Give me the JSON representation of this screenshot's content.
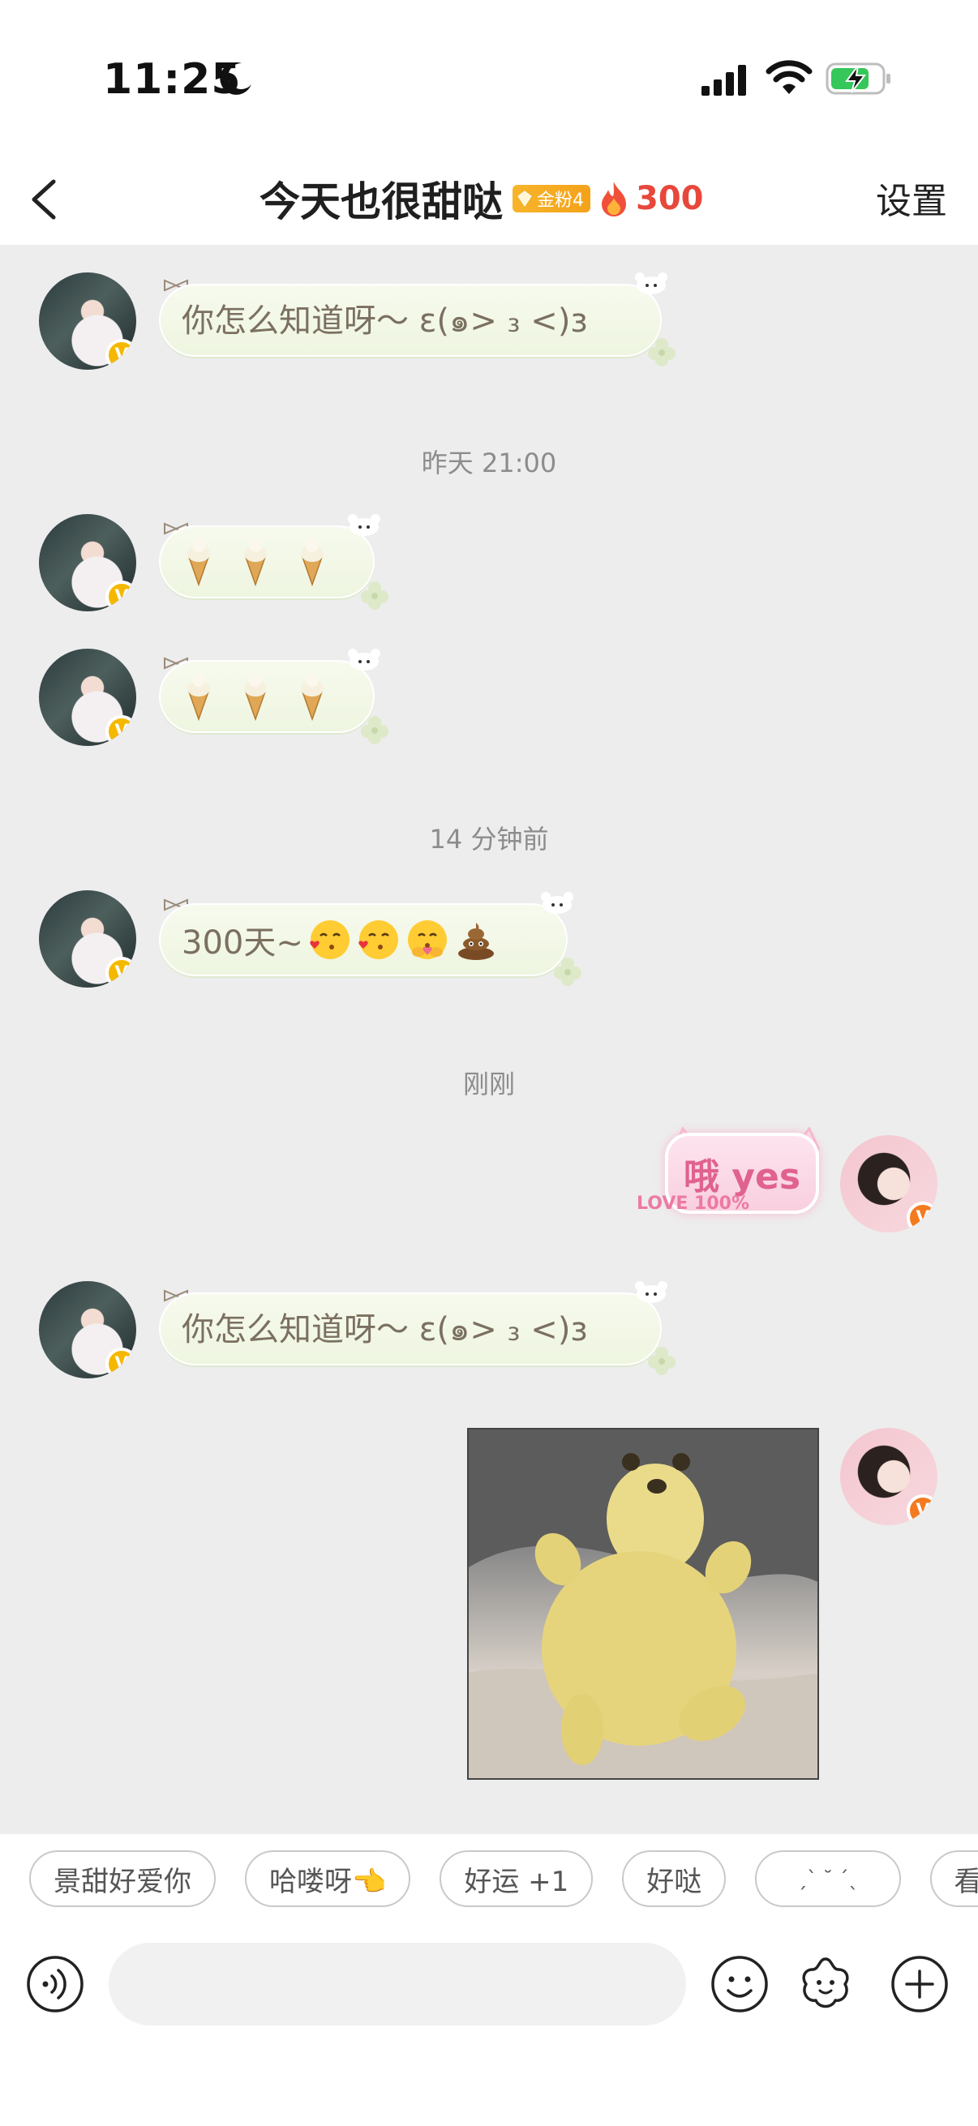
{
  "status_bar": {
    "time": "11:25"
  },
  "header": {
    "title": "今天也很甜哒",
    "fan_badge": "金粉4",
    "streak_count": "300",
    "settings_label": "设置"
  },
  "messages": [
    {
      "side": "left",
      "text": "你怎么知道呀～ ε(๑> ₃ <)з"
    },
    {
      "type": "timestamp",
      "text": "昨天 21:00"
    },
    {
      "side": "left",
      "type": "emoji",
      "emoji": "ice-cream-cone x3"
    },
    {
      "side": "left",
      "type": "emoji",
      "emoji": "ice-cream-cone x3"
    },
    {
      "type": "timestamp",
      "text": "14 分钟前"
    },
    {
      "side": "left",
      "text": "300天~"
    },
    {
      "type": "timestamp",
      "text": "刚刚"
    },
    {
      "side": "right",
      "type": "sticker",
      "text": "哦 yes",
      "sticker_text": "LOVE 100%"
    },
    {
      "side": "left",
      "text": "你怎么知道呀～ ε(๑> ₃ <)з"
    },
    {
      "side": "right",
      "type": "image",
      "image": "yellow-plush-toy-photo"
    }
  ],
  "quick_replies": [
    "景甜好爱你",
    "哈喽呀👈",
    "好运 +1",
    "好哒",
    "ˏˋ ˘ ˊˎ",
    "看到"
  ],
  "colors": {
    "accent_red": "#e8473b",
    "badge_gold": "#f4a21a",
    "verified_yellow": "#f5b800",
    "verified_orange": "#f47a20"
  }
}
